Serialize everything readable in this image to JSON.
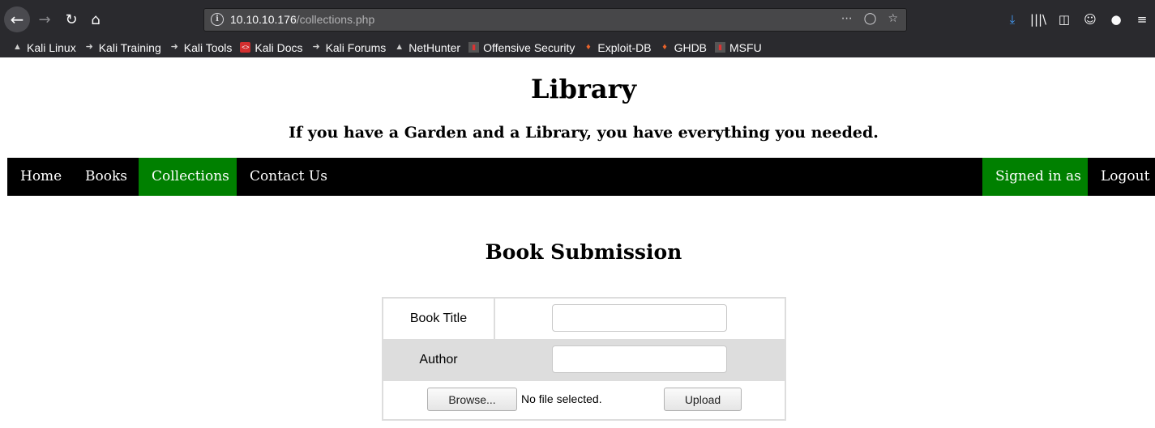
{
  "browser": {
    "url_host": "10.10.10.176",
    "url_path": "/collections.php",
    "bookmarks": [
      {
        "label": "Kali Linux",
        "icon": "kali-dragon-icon"
      },
      {
        "label": "Kali Training",
        "icon": "kali-dragon-icon"
      },
      {
        "label": "Kali Tools",
        "icon": "kali-dragon-icon"
      },
      {
        "label": "Kali Docs",
        "icon": "kali-docs-icon"
      },
      {
        "label": "Kali Forums",
        "icon": "kali-dragon-icon"
      },
      {
        "label": "NetHunter",
        "icon": "kali-dragon-icon"
      },
      {
        "label": "Offensive Security",
        "icon": "offsec-icon"
      },
      {
        "label": "Exploit-DB",
        "icon": "exploitdb-icon"
      },
      {
        "label": "GHDB",
        "icon": "exploitdb-icon"
      },
      {
        "label": "MSFU",
        "icon": "offsec-icon"
      }
    ]
  },
  "site": {
    "title": "Library",
    "tagline": "If you have a Garden and a Library, you have everything you needed."
  },
  "nav": {
    "home": "Home",
    "books": "Books",
    "collections": "Collections",
    "contact": "Contact Us",
    "signed_in": "Signed in as",
    "logout": "Logout",
    "active": "Collections",
    "active_color": "#008000"
  },
  "form": {
    "heading": "Book Submission",
    "book_title_label": "Book Title",
    "book_title_value": "",
    "author_label": "Author",
    "author_value": "",
    "browse_label": "Browse...",
    "file_status": "No file selected.",
    "upload_label": "Upload"
  }
}
